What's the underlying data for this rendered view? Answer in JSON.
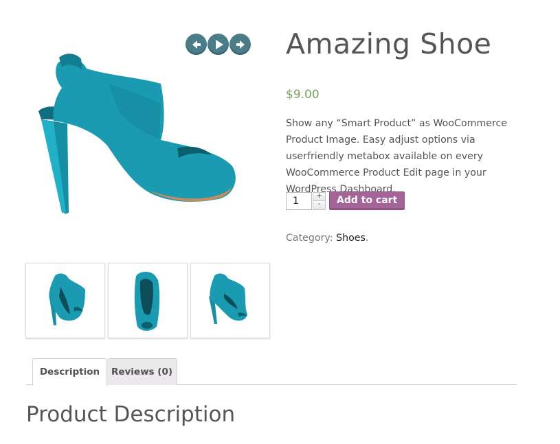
{
  "product": {
    "title": "Amazing Shoe",
    "price": "$9.00",
    "description": "Show any “Smart Product” as WooCommerce Product Image. Easy adjust options via userfriendly metabox available on every WooCommerce Product Edit page in your WordPress Dashboard.",
    "category_label": "Category:",
    "category_value": "Shoes",
    "category_suffix": "."
  },
  "cart": {
    "quantity": "1",
    "plus": "+",
    "minus": "-",
    "add_label": "Add to cart"
  },
  "slider_nav": {
    "icons": [
      "arrow-left-icon",
      "play-icon",
      "arrow-right-icon"
    ]
  },
  "tabs": [
    {
      "label": "Description",
      "active": true
    },
    {
      "label": "Reviews (0)",
      "active": false
    }
  ],
  "section": {
    "title": "Product Description"
  },
  "colors": {
    "price": "#77a464",
    "button": "#a46497",
    "nav": "#4a7d87",
    "shoe": "#1a9bb1"
  }
}
